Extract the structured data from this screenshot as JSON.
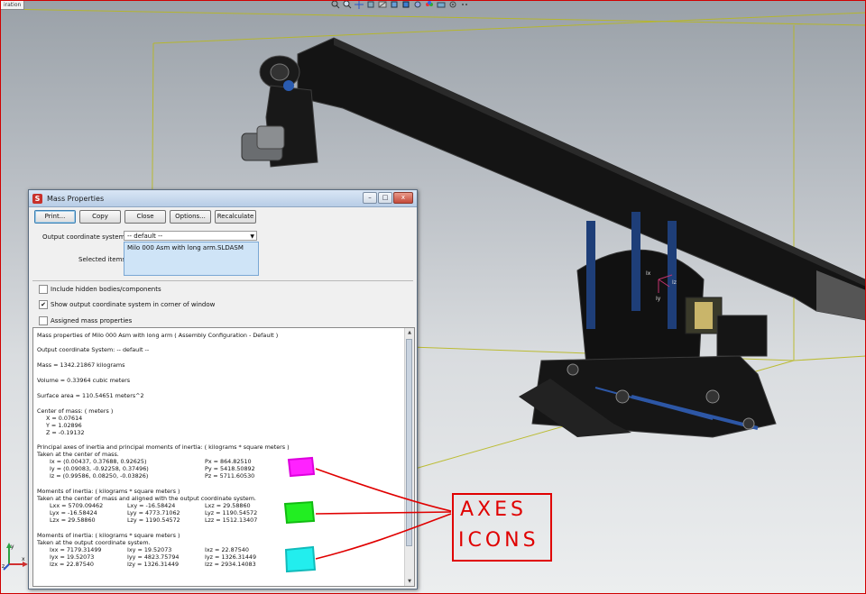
{
  "viewport": {
    "config_tag": "iration",
    "hud_icons": [
      "zoom-fit-icon",
      "zoom-area-icon",
      "pan-icon",
      "rotate-icon",
      "section-view-icon",
      "view-orientation-icon",
      "display-style-icon",
      "hide-show-icon",
      "appearance-icon",
      "scene-icon",
      "view-settings-icon",
      "more-icon"
    ]
  },
  "dialog": {
    "title": "Mass Properties",
    "window_controls": {
      "minimize": "–",
      "maximize": "□",
      "close": "x"
    },
    "buttons": {
      "print": "Print...",
      "copy": "Copy",
      "close": "Close",
      "options": "Options...",
      "recalculate": "Recalculate"
    },
    "output_coordinate_system": {
      "label": "Output coordinate system:",
      "value": "-- default --"
    },
    "selected_items": {
      "label": "Selected items:",
      "items": [
        "Milo 000 Asm with long arm.SLDASM"
      ]
    },
    "checkboxes": {
      "include_hidden": {
        "label": "Include hidden bodies/components",
        "checked": false
      },
      "show_output_cs": {
        "label": "Show output coordinate system in corner of window",
        "checked": true
      },
      "assigned_mass": {
        "label": "Assigned mass properties",
        "checked": false
      }
    },
    "results": {
      "header": "Mass properties of Milo 000 Asm with long arm ( Assembly Configuration - Default )",
      "output_cs": "Output  coordinate System: -- default --",
      "mass": "Mass = 1342.21867 kilograms",
      "volume": "Volume = 0.33964 cubic meters",
      "surface_area": "Surface area = 110.54651 meters^2",
      "center_of_mass": {
        "title": "Center of mass: ( meters )",
        "x": "X = 0.07614",
        "y": "Y = 1.02896",
        "z": "Z = -0.19132"
      },
      "principal": {
        "title": "Principal axes of inertia and principal moments of inertia: ( kilograms * square meters )",
        "subtitle": "Taken at the center of mass.",
        "rows": [
          {
            "axis": "Ix = (0.00437, 0.37688, 0.92625)",
            "moment": "Px = 864.82510"
          },
          {
            "axis": "Iy = (0.09083, -0.92258, 0.37496)",
            "moment": "Py = 5418.50892"
          },
          {
            "axis": "Iz = (0.99586, 0.08250, -0.03826)",
            "moment": "Pz = 5711.60530"
          }
        ]
      },
      "moments_com": {
        "title": "Moments of inertia: ( kilograms * square meters )",
        "subtitle": "Taken at the center of mass and aligned with the output coordinate system.",
        "rows": [
          [
            "Lxx = 5709.09462",
            "Lxy = -16.58424",
            "Lxz = 29.58860"
          ],
          [
            "Lyx = -16.58424",
            "Lyy = 4773.71062",
            "Lyz = 1190.54572"
          ],
          [
            "Lzx = 29.58860",
            "Lzy = 1190.54572",
            "Lzz = 1512.13407"
          ]
        ]
      },
      "moments_out": {
        "title": "Moments of inertia: ( kilograms * square meters )",
        "subtitle": "Taken at the output coordinate system.",
        "rows": [
          [
            "Ixx = 7179.31499",
            "Ixy = 19.52073",
            "Ixz = 22.87540"
          ],
          [
            "Iyx = 19.52073",
            "Iyy = 4823.75794",
            "Iyz = 1326.31449"
          ],
          [
            "Izx = 22.87540",
            "Izy = 1326.31449",
            "Izz = 2934.14083"
          ]
        ]
      }
    }
  },
  "annotation": {
    "line1": "AXES",
    "line2": "ICONS",
    "colors": {
      "pen": "#e00000",
      "magenta": "#ff22ff",
      "green": "#22ee22",
      "cyan": "#22eeee"
    }
  },
  "triad_labels": {
    "x": "x",
    "y": "y",
    "z": "z"
  }
}
